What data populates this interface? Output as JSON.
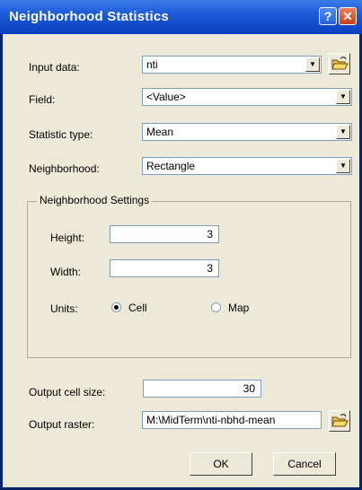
{
  "window": {
    "title": "Neighborhood Statistics",
    "help_label": "?",
    "close_label": "✕"
  },
  "input_data": {
    "label": "Input data:",
    "value": "nti"
  },
  "field": {
    "label": "Field:",
    "value": "<Value>"
  },
  "statistic_type": {
    "label": "Statistic type:",
    "value": "Mean"
  },
  "neighborhood": {
    "label": "Neighborhood:",
    "value": "Rectangle"
  },
  "settings": {
    "title": "Neighborhood Settings",
    "height_label": "Height:",
    "height_value": "3",
    "width_label": "Width:",
    "width_value": "3",
    "units_label": "Units:",
    "units_options": [
      "Cell",
      "Map"
    ],
    "units_selected": "Cell"
  },
  "output_cell_size": {
    "label": "Output cell size:",
    "value": "30"
  },
  "output_raster": {
    "label": "Output raster:",
    "value": "M:\\MidTerm\\nti-nbhd-mean"
  },
  "buttons": {
    "ok": "OK",
    "cancel": "Cancel"
  },
  "icons": {
    "dropdown": "dropdown-arrow-icon",
    "browse": "open-folder-icon"
  }
}
